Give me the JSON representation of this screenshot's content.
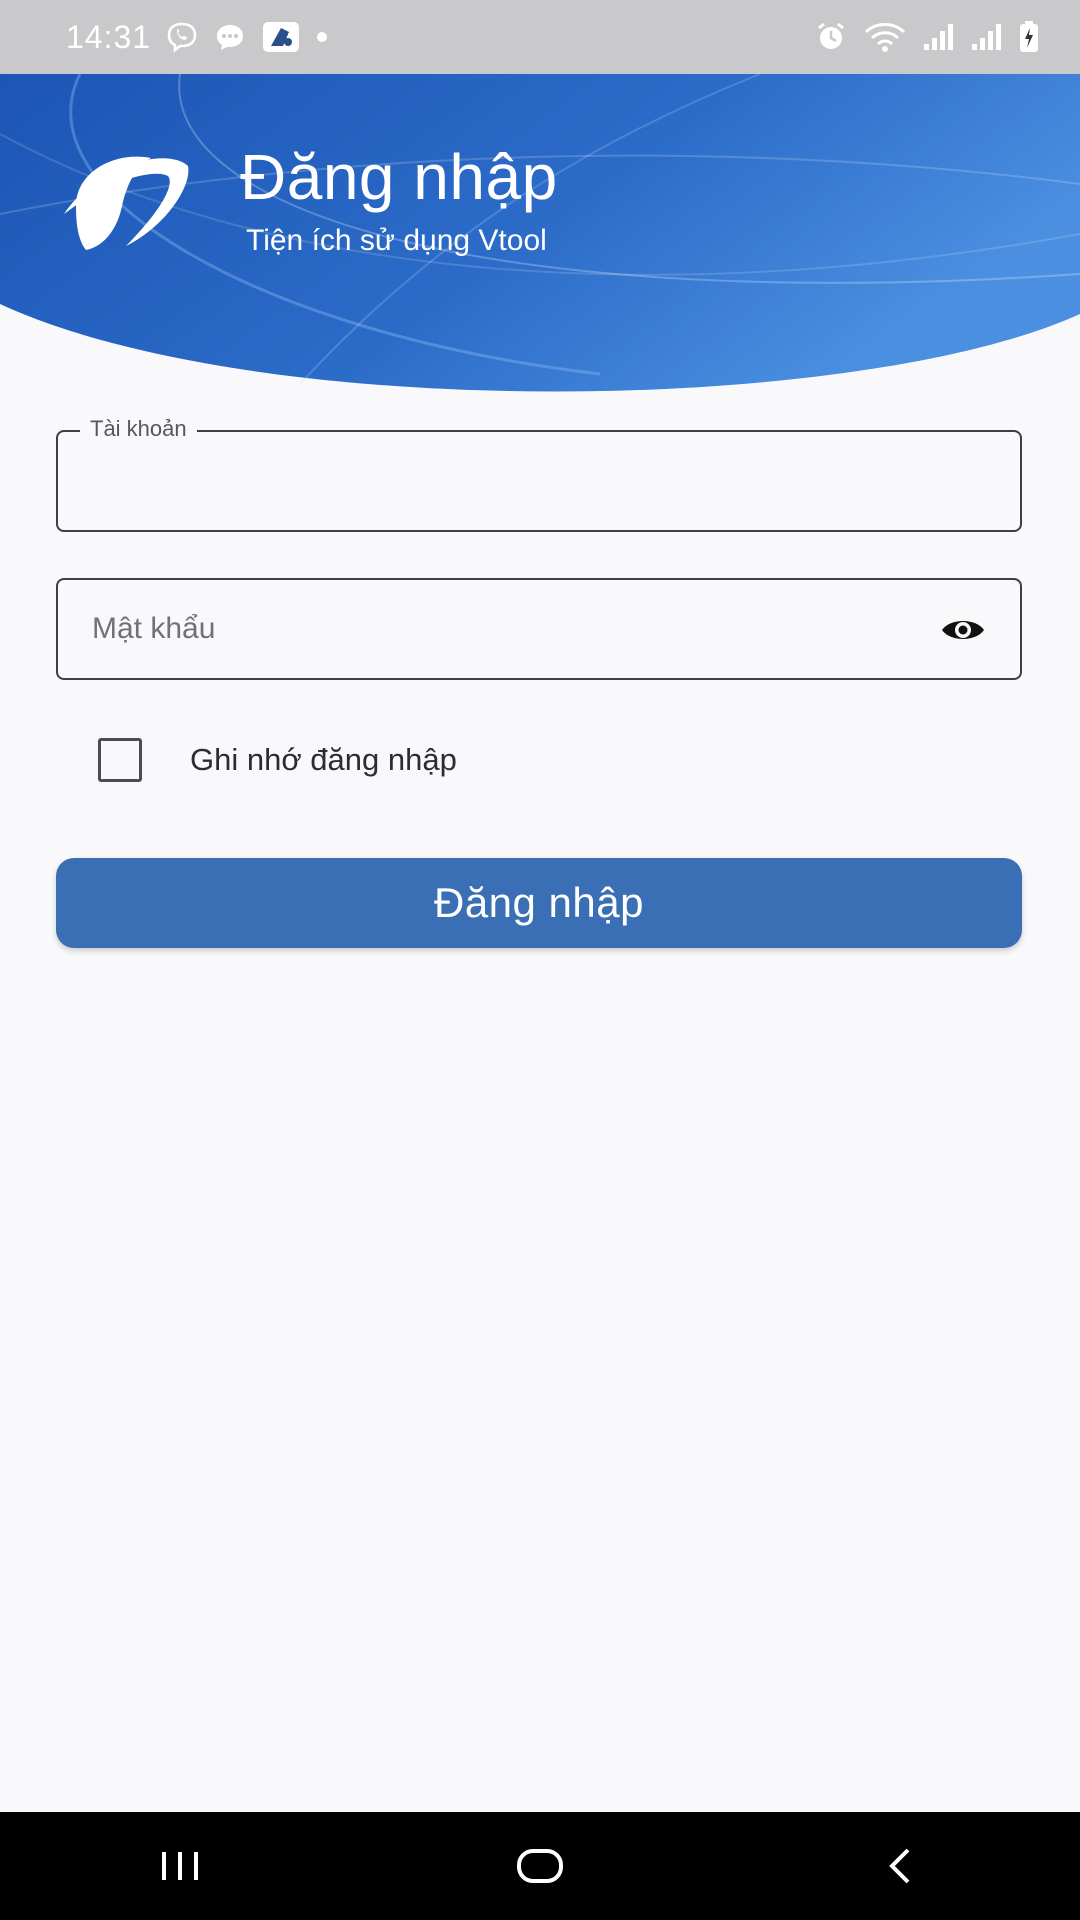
{
  "status_bar": {
    "time": "14:31",
    "left_icons": [
      "viber-icon",
      "chat-bubble-icon",
      "app-notification-icon",
      "dot-icon"
    ],
    "right_icons": [
      "alarm-icon",
      "wifi-icon",
      "signal-icon",
      "signal-icon",
      "battery-charging-icon"
    ]
  },
  "header": {
    "title": "Đăng nhập",
    "subtitle": "Tiện ích sử dụng Vtool",
    "logo_icon": "vnpt-logo-icon",
    "gradient": [
      "#1e5bb8",
      "#4a8fe0"
    ]
  },
  "form": {
    "username": {
      "label": "Tài khoản",
      "value": ""
    },
    "password": {
      "placeholder": "Mật khẩu",
      "value": "",
      "toggle_icon": "eye-icon"
    },
    "remember": {
      "label": "Ghi nhớ đăng nhập",
      "checked": false
    },
    "submit_label": "Đăng nhập"
  },
  "nav_bar": {
    "buttons": [
      "recent-apps-icon",
      "home-icon",
      "back-icon"
    ]
  },
  "colors": {
    "accent": "#3a6fb6",
    "background": "#f9f9fb",
    "status_bar": "#c9c9cb",
    "nav_bar": "#000000"
  }
}
